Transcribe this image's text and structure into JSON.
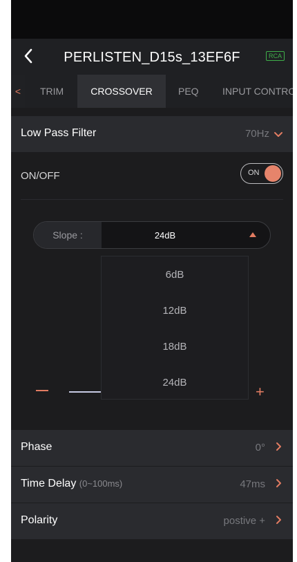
{
  "header": {
    "title": "PERLISTEN_D15s_13EF6F",
    "badge": "RCA"
  },
  "tabs": {
    "prev_arrow": "<",
    "items": [
      "TRIM",
      "CROSSOVER",
      "PEQ",
      "INPUT CONTRO"
    ],
    "active": "CROSSOVER"
  },
  "filter": {
    "label": "Low Pass Filter",
    "value": "70Hz"
  },
  "onoff": {
    "label": "ON/OFF",
    "toggle_text": "ON",
    "state": "on"
  },
  "slope": {
    "label": "Slope :",
    "value": "24dB",
    "options": [
      "6dB",
      "12dB",
      "18dB",
      "24dB"
    ]
  },
  "rows": {
    "phase": {
      "label": "Phase",
      "value": "0°"
    },
    "delay": {
      "label": "Time Delay",
      "sub": "(0~100ms)",
      "value": "47ms"
    },
    "polarity": {
      "label": "Polarity",
      "value": "postive +"
    }
  },
  "colors": {
    "accent": "#e27c62",
    "badge": "#3fb04a",
    "panel": "#2a2b2f",
    "background": "#1c1c1e"
  }
}
